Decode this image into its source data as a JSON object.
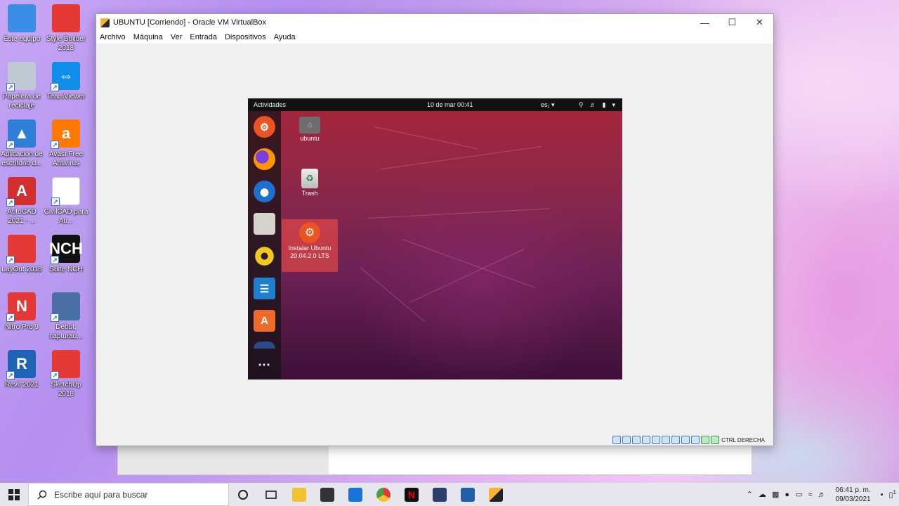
{
  "desktop": {
    "icons": [
      {
        "label": "Este equipo",
        "icon": "computer-icon",
        "color": "#3a8ee6"
      },
      {
        "label": "Style Builder 2018",
        "icon": "stylebuilder-icon",
        "color": "#e53935"
      },
      {
        "label": "Papelera de reciclaje",
        "icon": "recycle-bin-icon",
        "color": "#bfc9d4"
      },
      {
        "label": "TeamViewer",
        "icon": "teamviewer-icon",
        "color": "#0e8ee9"
      },
      {
        "label": "Aplicación de escritorio d...",
        "icon": "azure-icon",
        "color": "#2f7fd8"
      },
      {
        "label": "Avast Free Antivirus",
        "icon": "avast-icon",
        "color": "#ff7800"
      },
      {
        "label": "AutoCAD 2021 - ...",
        "icon": "autocad-icon",
        "color": "#d32f2f"
      },
      {
        "label": "CivilCAD para Au...",
        "icon": "file-icon",
        "color": "#ffffff"
      },
      {
        "label": "LayOut 2018",
        "icon": "layout-icon",
        "color": "#e53935"
      },
      {
        "label": "Suite NCH",
        "icon": "nch-icon",
        "color": "#111111"
      },
      {
        "label": "Nitro Pro 9",
        "icon": "nitro-icon",
        "color": "#e53935"
      },
      {
        "label": "Debut, capturad...",
        "icon": "debut-icon",
        "color": "#4a6fa5"
      },
      {
        "label": "Revit 2021",
        "icon": "revit-icon",
        "color": "#1e63b6"
      },
      {
        "label": "SketchUp 2018",
        "icon": "sketchup-icon",
        "color": "#e53935"
      }
    ]
  },
  "vbox": {
    "title": "UBUNTU  [Corriendo] - Oracle VM VirtualBox",
    "menu": [
      "Archivo",
      "Máquina",
      "Ver",
      "Entrada",
      "Dispositivos",
      "Ayuda"
    ],
    "host_key": "CTRL DERECHA"
  },
  "ubuntu": {
    "activities": "Actividades",
    "clock": "10 de mar  00:41",
    "lang": "es₁ ▾",
    "desktop_icons": [
      {
        "label": "ubuntu"
      },
      {
        "label": "Trash"
      },
      {
        "label": "Instalar Ubuntu 20.04.2.0 LTS"
      }
    ]
  },
  "taskbar": {
    "search_placeholder": "Escribe aquí para buscar",
    "time": "06:41 p. m.",
    "date": "09/03/2021",
    "notification_count": "1"
  }
}
